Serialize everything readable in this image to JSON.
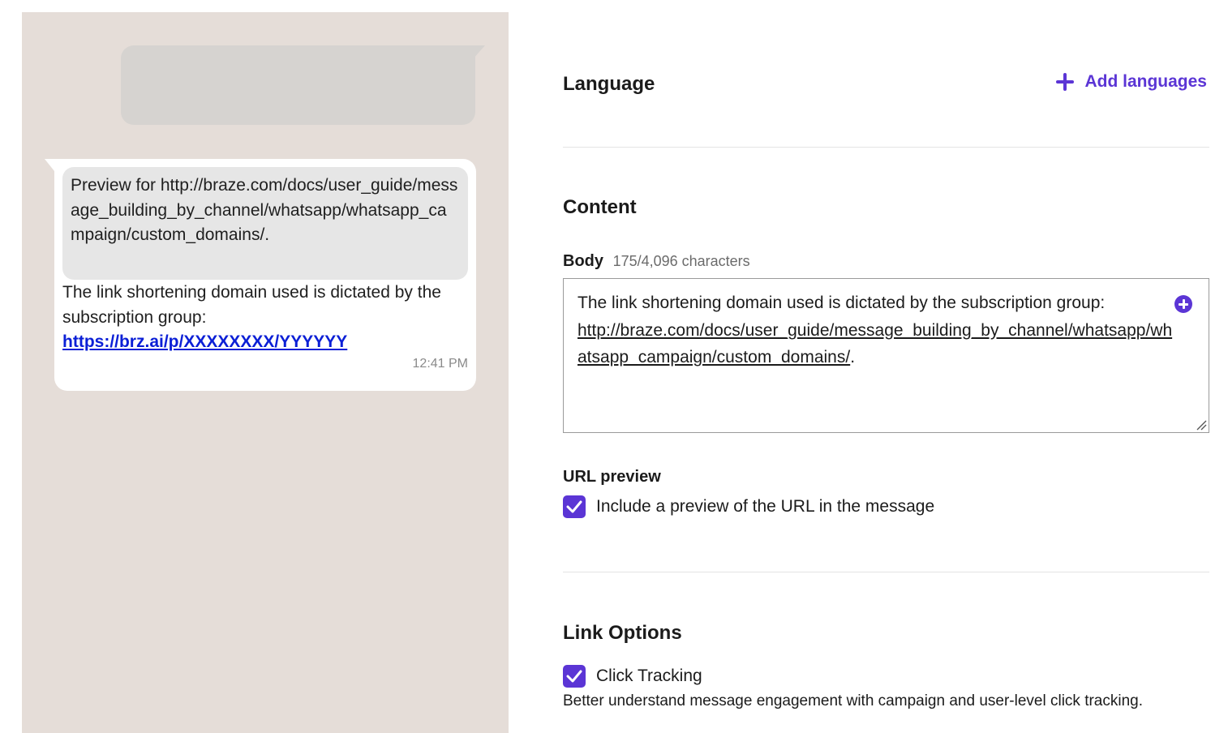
{
  "preview": {
    "url_preview_text": "Preview for http://braze.com/docs/user_guide/message_building_by_channel/whatsapp/whatsapp_campaign/custom_domains/.",
    "message_text": "The link shortening domain used is dictated by the subscription group:",
    "short_link": "https://brz.ai/p/XXXXXXXX/YYYYYY",
    "timestamp": "12:41 PM"
  },
  "language": {
    "title": "Language",
    "add_label": "Add languages",
    "add_icon": "plus-icon"
  },
  "content": {
    "title": "Content",
    "body_label": "Body",
    "char_count": "175/4,096 characters",
    "body_text": "The link shortening domain used is dictated by the subscription group:",
    "body_link": "http://braze.com/docs/user_guide/message_building_by_channel/whatsapp/whatsapp_campaign/custom_domains/",
    "body_suffix": "."
  },
  "url_preview": {
    "label": "URL preview",
    "checkbox_label": "Include a preview of the URL in the message",
    "checked": true
  },
  "link_options": {
    "title": "Link Options",
    "click_tracking_label": "Click Tracking",
    "click_tracking_checked": true,
    "help_text": "Better understand message engagement with campaign and user-level click tracking."
  },
  "colors": {
    "accent": "#5b35d5",
    "preview_bg": "#e5ddd8",
    "link_blue": "#0b1fd6"
  }
}
